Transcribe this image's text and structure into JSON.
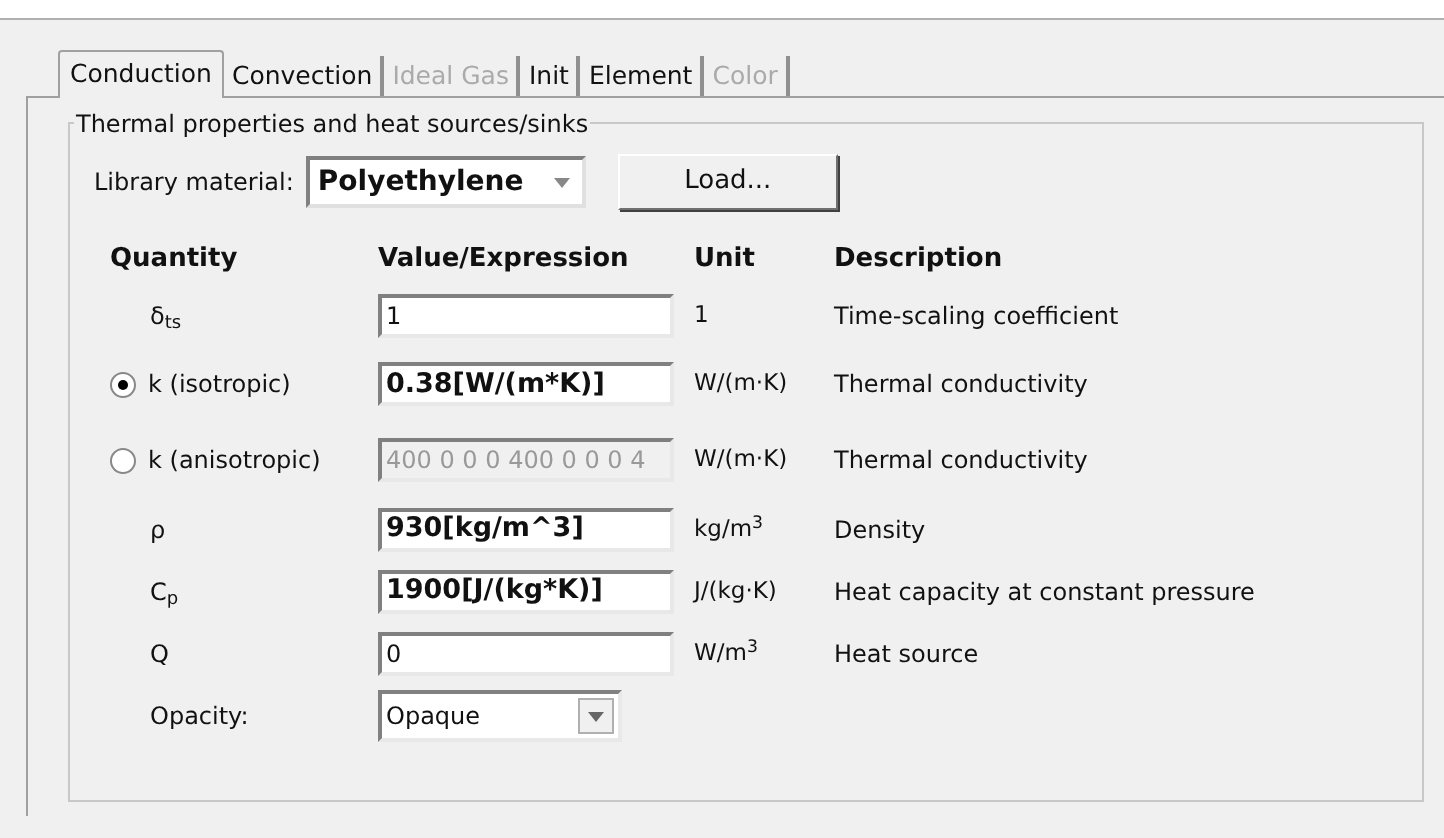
{
  "tabs": [
    {
      "label": "Conduction",
      "selected": true,
      "disabled": false
    },
    {
      "label": "Convection",
      "selected": false,
      "disabled": false
    },
    {
      "label": "Ideal Gas",
      "selected": false,
      "disabled": true
    },
    {
      "label": "Init",
      "selected": false,
      "disabled": false
    },
    {
      "label": "Element",
      "selected": false,
      "disabled": false
    },
    {
      "label": "Color",
      "selected": false,
      "disabled": true
    }
  ],
  "group": {
    "title": "Thermal properties and heat sources/sinks",
    "library": {
      "label": "Library material:",
      "value": "Polyethylene",
      "button": "Load..."
    },
    "columns": [
      "Quantity",
      "Value/Expression",
      "Unit",
      "Description"
    ],
    "rows": [
      {
        "kind": "plain",
        "quantity": "δ$_{ts}$",
        "value": "1",
        "bold": false,
        "disabled": false,
        "unit": "1",
        "description": "Time-scaling coefficient"
      },
      {
        "kind": "radio",
        "selected": true,
        "quantity": "k (isotropic)",
        "value": "0.38[W/(m*K)]",
        "bold": true,
        "disabled": false,
        "unit": "W/(m·K)",
        "description": "Thermal conductivity"
      },
      {
        "kind": "radio",
        "selected": false,
        "quantity": "k (anisotropic)",
        "value": "400 0 0 0 400 0 0 0 4",
        "bold": false,
        "disabled": true,
        "unit": "W/(m·K)",
        "description": "Thermal conductivity"
      },
      {
        "kind": "plain",
        "quantity": "ρ",
        "value": "930[kg/m^3]",
        "bold": true,
        "disabled": false,
        "unit": "kg/m$^{3}$",
        "description": "Density"
      },
      {
        "kind": "plain",
        "quantity": "C$_{p}$",
        "value": "1900[J/(kg*K)]",
        "bold": true,
        "disabled": false,
        "unit": "J/(kg·K)",
        "description": "Heat capacity at constant pressure"
      },
      {
        "kind": "plain",
        "quantity": "Q",
        "value": "0",
        "bold": false,
        "disabled": false,
        "unit": "W/m$^{3}$",
        "description": "Heat source"
      }
    ],
    "opacity": {
      "label": "Opacity:",
      "value": "Opaque"
    }
  }
}
